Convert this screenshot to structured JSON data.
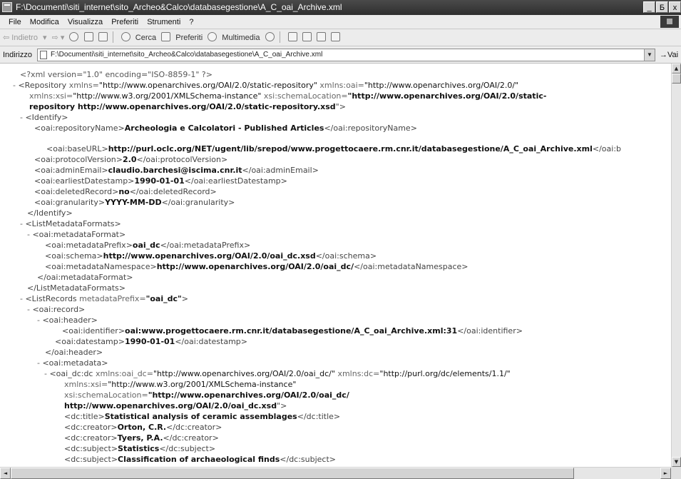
{
  "window": {
    "title": "F:\\Documenti\\siti_internet\\sito_Archeo&Calco\\databasegestione\\A_C_oai_Archive.xml",
    "buttons": [
      "_",
      "Б",
      "x"
    ]
  },
  "menu": [
    "File",
    "Modifica",
    "Visualizza",
    "Preferiti",
    "Strumenti",
    "?"
  ],
  "toolbar": {
    "back": "⇦ Indietro",
    "search": "Cerca",
    "favorites": "Preferiti",
    "multimedia": "Multimedia"
  },
  "address": {
    "label": "Indirizzo",
    "value": "F:\\Documenti\\siti_internet\\sito_Archeo&Calco\\databasegestione\\A_C_oai_Archive.xml",
    "go": "Vai"
  },
  "xml_lines": [
    [
      {
        "c": "pi",
        "t": "<?xml version=\"1.0\" encoding=\"ISO-8859-1\" ?>"
      }
    ],
    [
      {
        "c": "m",
        "t": "- "
      },
      {
        "c": "t",
        "t": "<Repository "
      },
      {
        "c": "m",
        "t": "xmlns="
      },
      {
        "c": "av",
        "t": "\"http://www.openarchives.org/OAI/2.0/static-repository\""
      },
      {
        "c": "m",
        "t": " xmlns:oai="
      },
      {
        "c": "av",
        "t": "\"http://www.openarchives.org/OAI/2.0/\""
      }
    ],
    [
      {
        "c": "m",
        "t": "xmlns:xsi="
      },
      {
        "c": "av",
        "t": "\"http://www.w3.org/2001/XMLSchema-instance\""
      },
      {
        "c": "m",
        "t": " xsi:schemaLocation="
      },
      {
        "c": "b",
        "t": "\"http://www.openarchives.org/OAI/2.0/static-"
      }
    ],
    [
      {
        "c": "b",
        "t": "repository http://www.openarchives.org/OAI/2.0/static-repository.xsd"
      },
      {
        "c": "t",
        "t": "\">"
      }
    ],
    [
      {
        "c": "m",
        "t": "- "
      },
      {
        "c": "t",
        "t": "<Identify>"
      }
    ],
    [
      {
        "c": "t",
        "t": "<oai:repositoryName>"
      },
      {
        "c": "b",
        "t": "Archeologia e Calcolatori - Published Articles"
      },
      {
        "c": "t",
        "t": "</oai:repositoryName>"
      }
    ],
    [
      {
        "c": "t",
        "t": "<oai:baseURL>"
      },
      {
        "c": "b",
        "t": "http://purl.oclc.org/NET/ugent/lib/srepod/www.progettocaere.rm.cnr.it/databasegestione/A_C_oai_Archive.xml"
      },
      {
        "c": "t",
        "t": "</oai:b"
      }
    ],
    [
      {
        "c": "t",
        "t": "<oai:protocolVersion>"
      },
      {
        "c": "b",
        "t": "2.0"
      },
      {
        "c": "t",
        "t": "</oai:protocolVersion>"
      }
    ],
    [
      {
        "c": "t",
        "t": "<oai:adminEmail>"
      },
      {
        "c": "b",
        "t": "claudio.barchesi@iscima.cnr.it"
      },
      {
        "c": "t",
        "t": "</oai:adminEmail>"
      }
    ],
    [
      {
        "c": "t",
        "t": "<oai:earliestDatestamp>"
      },
      {
        "c": "b",
        "t": "1990-01-01"
      },
      {
        "c": "t",
        "t": "</oai:earliestDatestamp>"
      }
    ],
    [
      {
        "c": "t",
        "t": "<oai:deletedRecord>"
      },
      {
        "c": "b",
        "t": "no"
      },
      {
        "c": "t",
        "t": "</oai:deletedRecord>"
      }
    ],
    [
      {
        "c": "t",
        "t": "<oai:granularity>"
      },
      {
        "c": "b",
        "t": "YYYY-MM-DD"
      },
      {
        "c": "t",
        "t": "</oai:granularity>"
      }
    ],
    [
      {
        "c": "t",
        "t": "</Identify>"
      }
    ],
    [
      {
        "c": "m",
        "t": "- "
      },
      {
        "c": "t",
        "t": "<ListMetadataFormats>"
      }
    ],
    [
      {
        "c": "m",
        "t": "- "
      },
      {
        "c": "t",
        "t": "<oai:metadataFormat>"
      }
    ],
    [
      {
        "c": "t",
        "t": "<oai:metadataPrefix>"
      },
      {
        "c": "b",
        "t": "oai_dc"
      },
      {
        "c": "t",
        "t": "</oai:metadataPrefix>"
      }
    ],
    [
      {
        "c": "t",
        "t": "<oai:schema>"
      },
      {
        "c": "b",
        "t": "http://www.openarchives.org/OAI/2.0/oai_dc.xsd"
      },
      {
        "c": "t",
        "t": "</oai:schema>"
      }
    ],
    [
      {
        "c": "t",
        "t": "<oai:metadataNamespace>"
      },
      {
        "c": "b",
        "t": "http://www.openarchives.org/OAI/2.0/oai_dc/"
      },
      {
        "c": "t",
        "t": "</oai:metadataNamespace>"
      }
    ],
    [
      {
        "c": "t",
        "t": "</oai:metadataFormat>"
      }
    ],
    [
      {
        "c": "t",
        "t": "</ListMetadataFormats>"
      }
    ],
    [
      {
        "c": "m",
        "t": "- "
      },
      {
        "c": "t",
        "t": "<ListRecords "
      },
      {
        "c": "m",
        "t": "metadataPrefix="
      },
      {
        "c": "b",
        "t": "\"oai_dc\""
      },
      {
        "c": "t",
        "t": ">"
      }
    ],
    [
      {
        "c": "m",
        "t": "- "
      },
      {
        "c": "t",
        "t": "<oai:record>"
      }
    ],
    [
      {
        "c": "m",
        "t": "- "
      },
      {
        "c": "t",
        "t": "<oai:header>"
      }
    ],
    [
      {
        "c": "t",
        "t": "<oai:identifier>"
      },
      {
        "c": "b",
        "t": "oai:www.progettocaere.rm.cnr.it/databasegestione/A_C_oai_Archive.xml:31"
      },
      {
        "c": "t",
        "t": "</oai:identifier>"
      }
    ],
    [
      {
        "c": "t",
        "t": "<oai:datestamp>"
      },
      {
        "c": "b",
        "t": "1990-01-01"
      },
      {
        "c": "t",
        "t": "</oai:datestamp>"
      }
    ],
    [
      {
        "c": "t",
        "t": "</oai:header>"
      }
    ],
    [
      {
        "c": "m",
        "t": "- "
      },
      {
        "c": "t",
        "t": "<oai:metadata>"
      }
    ],
    [
      {
        "c": "m",
        "t": "- "
      },
      {
        "c": "t",
        "t": "<oai_dc:dc "
      },
      {
        "c": "m",
        "t": "xmlns:oai_dc="
      },
      {
        "c": "av",
        "t": "\"http://www.openarchives.org/OAI/2.0/oai_dc/\""
      },
      {
        "c": "m",
        "t": " xmlns:dc="
      },
      {
        "c": "av",
        "t": "\"http://purl.org/dc/elements/1.1/\""
      }
    ],
    [
      {
        "c": "m",
        "t": "xmlns:xsi="
      },
      {
        "c": "av",
        "t": "\"http://www.w3.org/2001/XMLSchema-instance\""
      }
    ],
    [
      {
        "c": "m",
        "t": "xsi:schemaLocation="
      },
      {
        "c": "b",
        "t": "\"http://www.openarchives.org/OAI/2.0/oai_dc/"
      }
    ],
    [
      {
        "c": "b",
        "t": "http://www.openarchives.org/OAI/2.0/oai_dc.xsd"
      },
      {
        "c": "t",
        "t": "\">"
      }
    ],
    [
      {
        "c": "t",
        "t": "<dc:title>"
      },
      {
        "c": "b",
        "t": "Statistical analysis of ceramic assemblages"
      },
      {
        "c": "t",
        "t": "</dc:title>"
      }
    ],
    [
      {
        "c": "t",
        "t": "<dc:creator>"
      },
      {
        "c": "b",
        "t": "Orton, C.R."
      },
      {
        "c": "t",
        "t": "</dc:creator>"
      }
    ],
    [
      {
        "c": "t",
        "t": "<dc:creator>"
      },
      {
        "c": "b",
        "t": "Tyers, P.A."
      },
      {
        "c": "t",
        "t": "</dc:creator>"
      }
    ],
    [
      {
        "c": "t",
        "t": "<dc:subject>"
      },
      {
        "c": "b",
        "t": "Statistics"
      },
      {
        "c": "t",
        "t": "</dc:subject>"
      }
    ],
    [
      {
        "c": "t",
        "t": "<dc:subject>"
      },
      {
        "c": "b",
        "t": "Classification of archaeological finds"
      },
      {
        "c": "t",
        "t": "</dc:subject>"
      }
    ]
  ]
}
